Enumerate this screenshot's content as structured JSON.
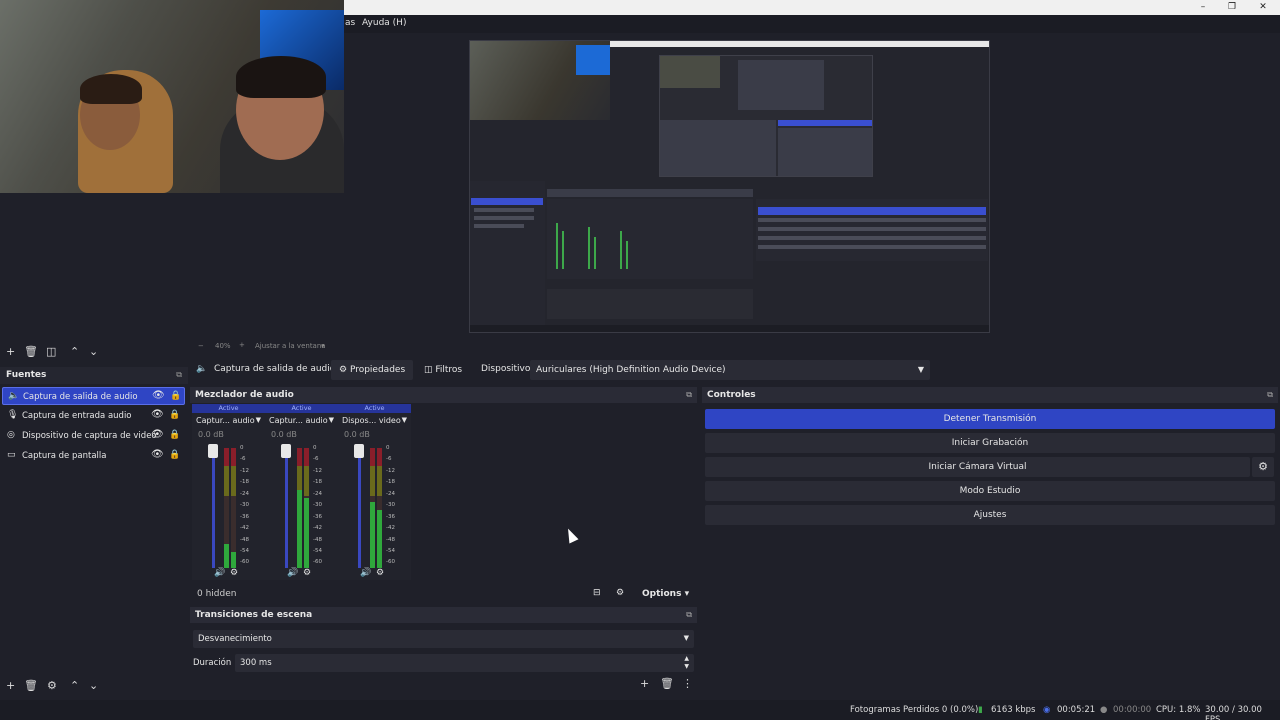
{
  "menubar": {
    "items": [
      "as",
      "Ayuda (H)"
    ]
  },
  "preview": {
    "zoom": "40%",
    "fit_label": "Ajustar a la ventana"
  },
  "fuentes": {
    "title": "Fuentes",
    "items": [
      {
        "label": "Captura de salida de audio",
        "icon": "speaker-icon",
        "selected": true
      },
      {
        "label": "Captura de entrada audio",
        "icon": "microphone-icon",
        "selected": false
      },
      {
        "label": "Dispositivo de captura de video",
        "icon": "camera-icon",
        "selected": false
      },
      {
        "label": "Captura de pantalla",
        "icon": "monitor-icon",
        "selected": false
      }
    ]
  },
  "propbar": {
    "source_name": "Captura de salida de audio",
    "properties_label": "Propiedades",
    "filters_label": "Filtros",
    "device_label": "Dispositivo",
    "device_value": "Auriculares (High Definition Audio Device)"
  },
  "mixer": {
    "title": "Mezclador de audio",
    "channels": [
      {
        "status": "Active",
        "name": "Captur... audio",
        "db": "0.0 dB",
        "level": 0.2
      },
      {
        "status": "Active",
        "name": "Captur... audio",
        "db": "0.0 dB",
        "level": 0.65
      },
      {
        "status": "Active",
        "name": "Dispos... video",
        "db": "0.0 dB",
        "level": 0.55
      }
    ],
    "scale": [
      "0",
      "-6",
      "-12",
      "-18",
      "-24",
      "-30",
      "-36",
      "-42",
      "-48",
      "-54",
      "-60"
    ],
    "hidden_label": "0 hidden",
    "options_label": "Options"
  },
  "transitions": {
    "title": "Transiciones de escena",
    "selected": "Desvanecimiento",
    "duration_label": "Duración",
    "duration_value": "300 ms"
  },
  "controls": {
    "title": "Controles",
    "stop_stream": "Detener Transmisión",
    "start_recording": "Iniciar Grabación",
    "start_virtual_cam": "Iniciar Cámara Virtual",
    "studio_mode": "Modo Estudio",
    "settings": "Ajustes"
  },
  "status": {
    "dropped_frames": "Fotogramas Perdidos 0 (0.0%)",
    "bitrate": "6163 kbps",
    "stream_time": "00:05:21",
    "rec_time": "00:00:00",
    "cpu": "CPU: 1.8%",
    "fps": "30.00 / 30.00 FPS"
  },
  "colors": {
    "accent": "#2f45c4",
    "background": "#1f2029",
    "meter_green": "#2fa83c"
  }
}
